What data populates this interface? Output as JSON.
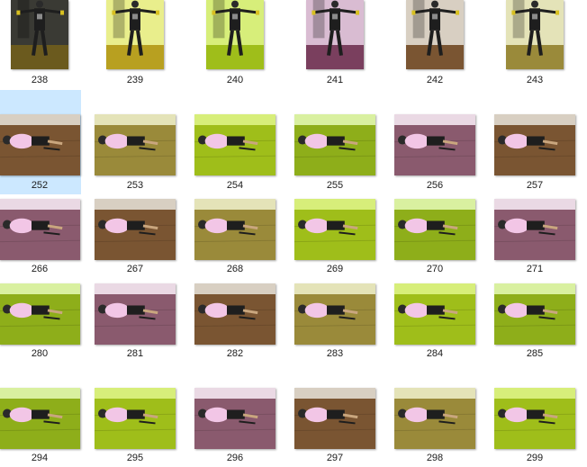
{
  "colors": {
    "selection": "#cce8ff",
    "text": "#1b1b1b"
  },
  "gallery": {
    "items": [
      {
        "label": "238",
        "pose": "standing",
        "tint": "olive-dark"
      },
      {
        "label": "239",
        "pose": "standing",
        "tint": "yellow"
      },
      {
        "label": "240",
        "pose": "standing",
        "tint": "lime"
      },
      {
        "label": "241",
        "pose": "standing",
        "tint": "magenta"
      },
      {
        "label": "242",
        "pose": "standing",
        "tint": "brown"
      },
      {
        "label": "243",
        "pose": "standing",
        "tint": "olive"
      },
      {
        "label": "252",
        "pose": "plank",
        "tint": "brown",
        "selected": true
      },
      {
        "label": "253",
        "pose": "plank",
        "tint": "olive"
      },
      {
        "label": "254",
        "pose": "plank",
        "tint": "lime"
      },
      {
        "label": "255",
        "pose": "plank",
        "tint": "green"
      },
      {
        "label": "256",
        "pose": "plank",
        "tint": "mauve"
      },
      {
        "label": "257",
        "pose": "plank",
        "tint": "brown"
      },
      {
        "label": "266",
        "pose": "plank",
        "tint": "mauve"
      },
      {
        "label": "267",
        "pose": "plank",
        "tint": "brown"
      },
      {
        "label": "268",
        "pose": "plank",
        "tint": "olive"
      },
      {
        "label": "269",
        "pose": "plank",
        "tint": "lime"
      },
      {
        "label": "270",
        "pose": "plank",
        "tint": "green"
      },
      {
        "label": "271",
        "pose": "plank",
        "tint": "mauve"
      },
      {
        "label": "280",
        "pose": "plank",
        "tint": "green"
      },
      {
        "label": "281",
        "pose": "plank",
        "tint": "mauve"
      },
      {
        "label": "282",
        "pose": "plank",
        "tint": "brown"
      },
      {
        "label": "283",
        "pose": "plank",
        "tint": "olive"
      },
      {
        "label": "284",
        "pose": "plank",
        "tint": "lime"
      },
      {
        "label": "285",
        "pose": "plank",
        "tint": "green"
      },
      {
        "label": "294",
        "pose": "plank",
        "tint": "green"
      },
      {
        "label": "295",
        "pose": "plank",
        "tint": "lime"
      },
      {
        "label": "296",
        "pose": "plank",
        "tint": "mauve"
      },
      {
        "label": "297",
        "pose": "plank",
        "tint": "brown"
      },
      {
        "label": "298",
        "pose": "plank",
        "tint": "olive"
      },
      {
        "label": "299",
        "pose": "plank",
        "tint": "lime"
      }
    ]
  }
}
